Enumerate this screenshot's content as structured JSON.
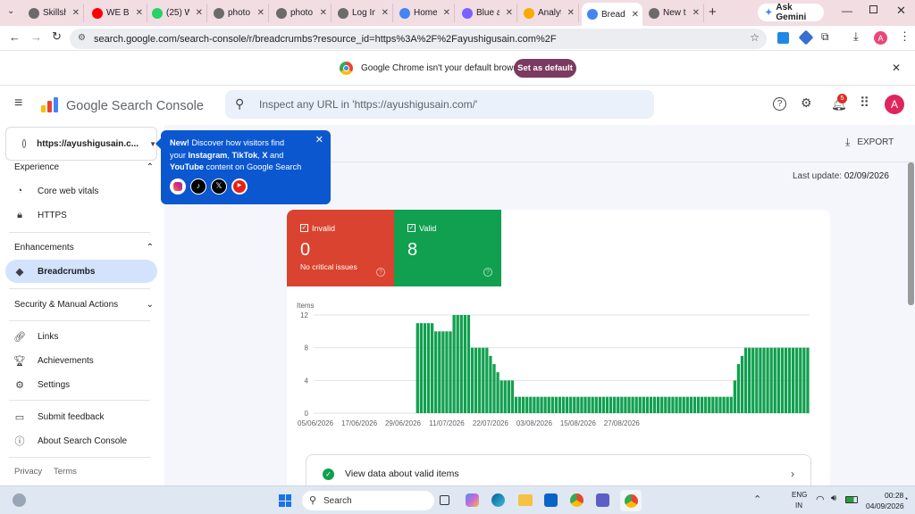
{
  "tabs": [
    {
      "label": "Skillsh",
      "color": "#6b6b6b"
    },
    {
      "label": "WE BI",
      "color": "#ff0000"
    },
    {
      "label": "(25) W",
      "color": "#25d366"
    },
    {
      "label": "photo",
      "color": "#6b6b6b"
    },
    {
      "label": "photo",
      "color": "#6b6b6b"
    },
    {
      "label": "Log In",
      "color": "#6b6b6b"
    },
    {
      "label": "Home",
      "color": "#4285f4"
    },
    {
      "label": "Blue a",
      "color": "#7b61ff"
    },
    {
      "label": "Analyt",
      "color": "#f9ab00"
    },
    {
      "label": "Bread",
      "color": "#4285f4"
    },
    {
      "label": "New t",
      "color": "#6b6b6b"
    }
  ],
  "ask_gemini": "Ask Gemini",
  "address": "search.google.com/search-console/r/breadcrumbs?resource_id=https%3A%2F%2Fayushigusain.com%2F",
  "profile_initial": "A",
  "infobar": {
    "message": "Google Chrome isn't your default browser",
    "button": "Set as default"
  },
  "gsc": {
    "product": "Google Search Console",
    "search_placeholder": "Inspect any URL in 'https://ayushigusain.com/'",
    "notif_count": "5",
    "avatar": "A",
    "property": "https://ayushigusain.c..."
  },
  "promo": {
    "line1_bold": "New!",
    "line1": " Discover how visitors find",
    "line2_pre": "your ",
    "line2_b1": "Instagram",
    "line2_mid": ", ",
    "line2_b2": "TikTok",
    "line2_mid2": ", ",
    "line2_b3": "X",
    "line2_post": " and",
    "line3_b": "YouTube",
    "line3": " content on Google Search"
  },
  "sidebar": {
    "experience": "Experience",
    "core_web_vitals": "Core web vitals",
    "https": "HTTPS",
    "enhancements": "Enhancements",
    "breadcrumbs": "Breadcrumbs",
    "security": "Security & Manual Actions",
    "links": "Links",
    "achievements": "Achievements",
    "settings": "Settings",
    "submit_feedback": "Submit feedback",
    "about": "About Search Console",
    "privacy": "Privacy",
    "terms": "Terms"
  },
  "export": "EXPORT",
  "last_update_label": "Last update:",
  "last_update_value": "02/09/2026",
  "status": {
    "invalid": {
      "label": "Invalid",
      "count": "0",
      "sub": "No critical issues",
      "color": "#d9432f"
    },
    "valid": {
      "label": "Valid",
      "count": "8",
      "color": "#11a04f"
    }
  },
  "view_valid": "View data about valid items",
  "chart_data": {
    "type": "bar",
    "ylabel": "Items",
    "ylim": [
      0,
      12
    ],
    "yticks": [
      0,
      4,
      8,
      12
    ],
    "x_tick_labels": [
      "05/06/2026",
      "17/06/2026",
      "29/06/2026",
      "11/07/2026",
      "22/07/2026",
      "03/08/2026",
      "15/08/2026",
      "27/08/2026"
    ],
    "x_start": "05/06/2026",
    "x_end": "02/09/2026",
    "series": [
      {
        "color": "#11a04f",
        "values": [
          0,
          0,
          0,
          0,
          0,
          0,
          0,
          0,
          0,
          0,
          0,
          0,
          0,
          0,
          0,
          0,
          0,
          0,
          0,
          0,
          0,
          0,
          0,
          0,
          0,
          0,
          0,
          0,
          11,
          11,
          11,
          11,
          11,
          10,
          10,
          10,
          10,
          10,
          12,
          12,
          12,
          12,
          12,
          8,
          8,
          8,
          8,
          8,
          7,
          6,
          5,
          4,
          4,
          4,
          4,
          2,
          2,
          2,
          2,
          2,
          2,
          2,
          2,
          2,
          2,
          2,
          2,
          2,
          2,
          2,
          2,
          2,
          2,
          2,
          2,
          2,
          2,
          2,
          2,
          2,
          2,
          2,
          2,
          2,
          2,
          2,
          2,
          2,
          2,
          2,
          2,
          2,
          2,
          2,
          2,
          2,
          2,
          2,
          2,
          2,
          2,
          2,
          2,
          2,
          2,
          2,
          2,
          2,
          2,
          2,
          2,
          2,
          2,
          2,
          2,
          4,
          6,
          7,
          8,
          8,
          8,
          8,
          8,
          8,
          8,
          8,
          8,
          8,
          8,
          8,
          8,
          8,
          8,
          8,
          8,
          8
        ]
      }
    ]
  },
  "taskbar": {
    "search": "Search",
    "lang1": "ENG",
    "lang2": "IN",
    "time": "00:28",
    "date": "04/09/2026"
  }
}
